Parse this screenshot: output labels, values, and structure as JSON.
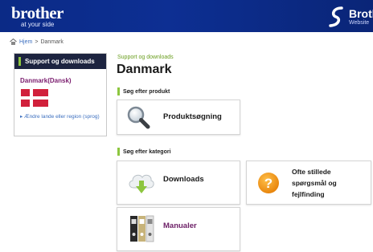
{
  "header": {
    "logo_word": "brother",
    "logo_tagline": "at your side",
    "right_brand": "Broth",
    "right_sub": "Website"
  },
  "breadcrumb": {
    "home": "Hjem",
    "separator": ">",
    "current": "Danmark"
  },
  "sidebar": {
    "title": "Support og downloads",
    "country": "Danmark(Dansk)",
    "change_link": "▸ Ændre lande eller region (sprog)"
  },
  "main": {
    "kicker": "Support og downloads",
    "title": "Danmark",
    "section_product": "Søg efter produkt",
    "product_search": "Produktsøgning",
    "section_category": "Søg efter kategori",
    "downloads": "Downloads",
    "faq_line1": "Ofte stillede",
    "faq_line2": "spørgsmål og",
    "faq_line3": "fejlfinding",
    "manuals": "Manualer"
  },
  "colors": {
    "header_blue": "#0d2f93",
    "sidebar_head": "#1d2440",
    "accent_green": "#8dc63f",
    "link_blue": "#3c6fbf",
    "country_purple": "#7a1c6e",
    "flag_red": "#d1203b"
  },
  "icons": [
    "brother-swoosh-icon",
    "home-icon",
    "denmark-flag-icon",
    "magnifier-icon",
    "cloud-download-icon",
    "question-icon",
    "binders-icon"
  ]
}
